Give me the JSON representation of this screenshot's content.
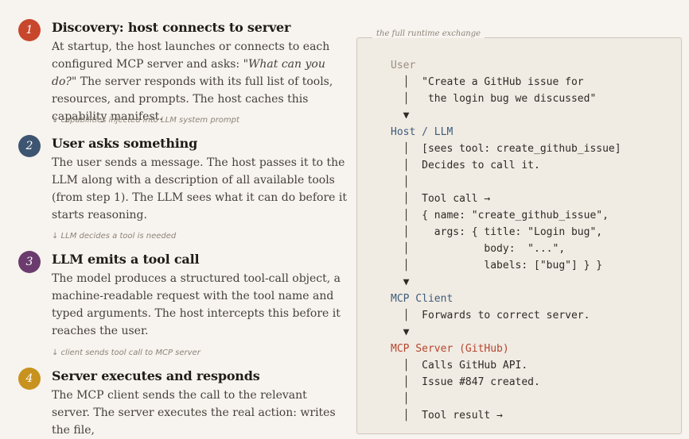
{
  "steps": [
    {
      "number": "1",
      "title": "Discovery: host connects to server",
      "body_pre": "At startup, the host launches or connects to each configured MCP server and asks: ",
      "body_quote": "\"What can you do?\"",
      "body_post": " The server responds with its full list of tools, resources, and prompts. The host caches this capability manifest.",
      "color": "#c8472c"
    },
    {
      "number": "2",
      "title": "User asks something",
      "body": "The user sends a message. The host passes it to the LLM along with a description of all available tools (from step 1). The LLM sees what it can do before it starts reasoning.",
      "color": "#3d5570"
    },
    {
      "number": "3",
      "title": "LLM emits a tool call",
      "body": "The model produces a structured tool-call object, a machine-readable request with the tool name and typed arguments. The host intercepts this before it reaches the user.",
      "color": "#6b3b6e"
    },
    {
      "number": "4",
      "title": "Server executes and responds",
      "body": "The MCP client sends the call to the relevant server. The server executes the real action: writes the file,",
      "color": "#c8921e"
    }
  ],
  "connectors": [
    "↓ capabilities injected into LLM system prompt",
    "↓ LLM decides a tool is needed",
    "↓ client sends tool call to MCP server"
  ],
  "panel": {
    "legend": "the full runtime exchange",
    "lines": [
      {
        "text": "User",
        "role": "user"
      },
      {
        "text": "  │  \"Create a GitHub issue for",
        "role": ""
      },
      {
        "text": "  │   the login bug we discussed\"",
        "role": ""
      },
      {
        "text": "  ▼",
        "role": ""
      },
      {
        "text": "Host / LLM",
        "role": "host"
      },
      {
        "text": "  │  [sees tool: create_github_issue]",
        "role": ""
      },
      {
        "text": "  │  Decides to call it.",
        "role": ""
      },
      {
        "text": "  │",
        "role": ""
      },
      {
        "text": "  │  Tool call →",
        "role": ""
      },
      {
        "text": "  │  { name: \"create_github_issue\",",
        "role": ""
      },
      {
        "text": "  │    args: { title: \"Login bug\",",
        "role": ""
      },
      {
        "text": "  │            body:  \"...\",",
        "role": ""
      },
      {
        "text": "  │            labels: [\"bug\"] } }",
        "role": ""
      },
      {
        "text": "  ▼",
        "role": ""
      },
      {
        "text": "MCP Client",
        "role": "client"
      },
      {
        "text": "  │  Forwards to correct server.",
        "role": ""
      },
      {
        "text": "  ▼",
        "role": ""
      },
      {
        "text": "MCP Server (GitHub)",
        "role": "server"
      },
      {
        "text": "  │  Calls GitHub API.",
        "role": ""
      },
      {
        "text": "  │  Issue #847 created.",
        "role": ""
      },
      {
        "text": "  │",
        "role": ""
      },
      {
        "text": "  │  Tool result →",
        "role": ""
      }
    ]
  }
}
